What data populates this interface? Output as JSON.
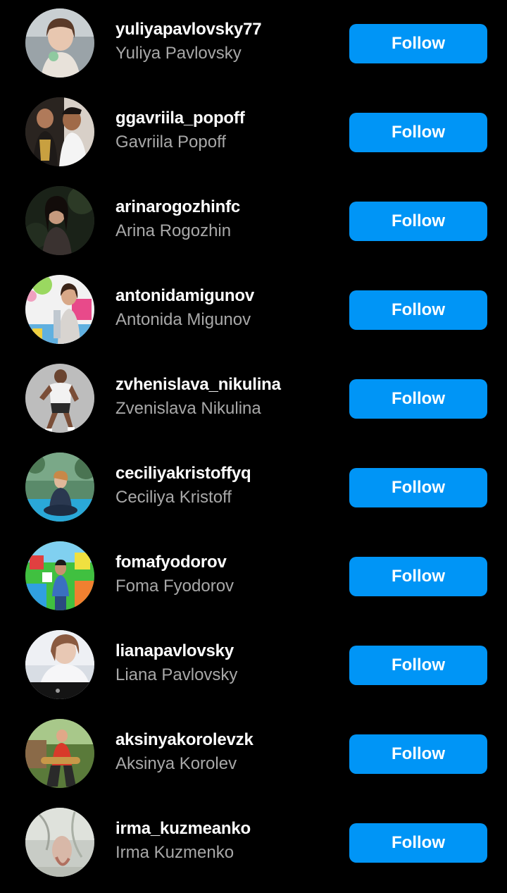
{
  "accent_color": "#0095f6",
  "background_color": "#000000",
  "suggestions": [
    {
      "username": "yuliyapavlovsky77",
      "full_name": "Yuliya Pavlovsky",
      "button_label": "Follow",
      "avatar_icon": "profile-photo-icon"
    },
    {
      "username": "ggavriila_popoff",
      "full_name": "Gavriila Popoff",
      "button_label": "Follow",
      "avatar_icon": "profile-photo-icon"
    },
    {
      "username": "arinarogozhinfc",
      "full_name": "Arina Rogozhin",
      "button_label": "Follow",
      "avatar_icon": "profile-photo-icon"
    },
    {
      "username": "antonidamigunov",
      "full_name": "Antonida Migunov",
      "button_label": "Follow",
      "avatar_icon": "profile-photo-icon"
    },
    {
      "username": "zvhenislava_nikulina",
      "full_name": "Zvenislava Nikulina",
      "button_label": "Follow",
      "avatar_icon": "profile-photo-icon"
    },
    {
      "username": "ceciliyakristoffyq",
      "full_name": "Ceciliya Kristoff",
      "button_label": "Follow",
      "avatar_icon": "profile-photo-icon"
    },
    {
      "username": "fomafyodorov",
      "full_name": "Foma Fyodorov",
      "button_label": "Follow",
      "avatar_icon": "profile-photo-icon"
    },
    {
      "username": "lianapavlovsky",
      "full_name": "Liana Pavlovsky",
      "button_label": "Follow",
      "avatar_icon": "profile-photo-icon"
    },
    {
      "username": "aksinyakorolevzk",
      "full_name": "Aksinya Korolev",
      "button_label": "Follow",
      "avatar_icon": "profile-photo-icon"
    },
    {
      "username": "irma_kuzmeanko",
      "full_name": "Irma Kuzmenko",
      "button_label": "Follow",
      "avatar_icon": "profile-photo-icon"
    }
  ]
}
